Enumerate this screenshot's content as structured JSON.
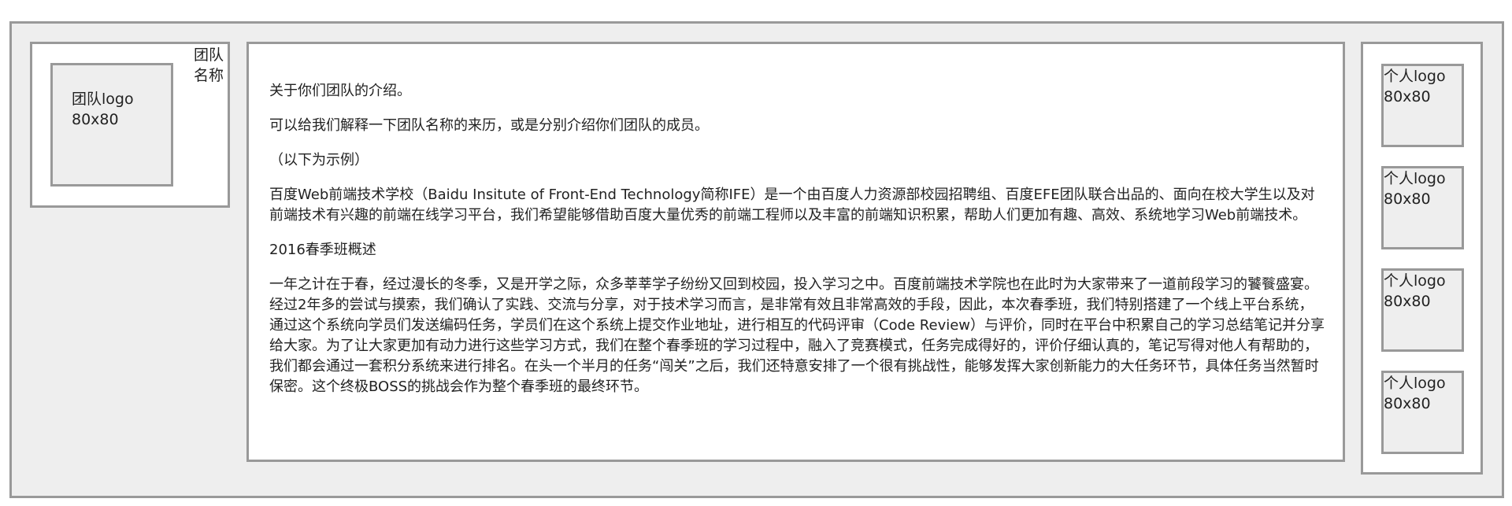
{
  "team": {
    "logo_label": "团队logo",
    "logo_size": "80x80",
    "name": "团队名称"
  },
  "content": {
    "paragraphs": [
      "关于你们团队的介绍。",
      "可以给我们解释一下团队名称的来历，或是分别介绍你们团队的成员。",
      "（以下为示例）",
      "百度Web前端技术学校（Baidu Insitute of Front-End Technology简称IFE）是一个由百度人力资源部校园招聘组、百度EFE团队联合出品的、面向在校大学生以及对前端技术有兴趣的前端在线学习平台，我们希望能够借助百度大量优秀的前端工程师以及丰富的前端知识积累，帮助人们更加有趣、高效、系统地学习Web前端技术。",
      "2016春季班概述",
      "一年之计在于春，经过漫长的冬季，又是开学之际，众多莘莘学子纷纷又回到校园，投入学习之中。百度前端技术学院也在此时为大家带来了一道前段学习的饕餮盛宴。经过2年多的尝试与摸索，我们确认了实践、交流与分享，对于技术学习而言，是非常有效且非常高效的手段，因此，本次春季班，我们特别搭建了一个线上平台系统，通过这个系统向学员们发送编码任务，学员们在这个系统上提交作业地址，进行相互的代码评审（Code Review）与评价，同时在平台中积累自己的学习总结笔记并分享给大家。为了让大家更加有动力进行这些学习方式，我们在整个春季班的学习过程中，融入了竞赛模式，任务完成得好的，评价仔细认真的，笔记写得对他人有帮助的，我们都会通过一套积分系统来进行排名。在头一个半月的任务“闯关”之后，我们还特意安排了一个很有挑战性，能够发挥大家创新能力的大任务环节，具体任务当然暂时保密。这个终极BOSS的挑战会作为整个春季班的最终环节。"
    ]
  },
  "members": [
    {
      "logo_label": "个人logo",
      "logo_size": "80x80"
    },
    {
      "logo_label": "个人logo",
      "logo_size": "80x80"
    },
    {
      "logo_label": "个人logo",
      "logo_size": "80x80"
    },
    {
      "logo_label": "个人logo",
      "logo_size": "80x80"
    }
  ]
}
